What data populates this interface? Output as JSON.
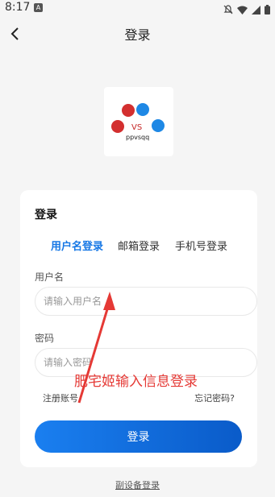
{
  "status_bar": {
    "time": "8:17",
    "notice_glyph": "A",
    "icons": [
      "bell-off-icon",
      "wifi-icon",
      "signal-icon",
      "battery-icon"
    ]
  },
  "header": {
    "title": "登录",
    "back_icon": "chevron-left-icon"
  },
  "logo": {
    "text_vs": "VS",
    "text_name": "ppvsqq"
  },
  "card": {
    "title": "登录",
    "tabs": [
      {
        "label": "用户名登录",
        "active": true
      },
      {
        "label": "邮箱登录",
        "active": false
      },
      {
        "label": "手机号登录",
        "active": false
      }
    ],
    "username": {
      "label": "用户名",
      "placeholder": "请输入用户名"
    },
    "password": {
      "label": "密码",
      "placeholder": "请输入密码"
    },
    "register_link": "注册账号",
    "forgot_link": "忘记密码?",
    "submit_label": "登录"
  },
  "footer_link": "副设备登录",
  "annotation": {
    "text": "肥宅姬输入信息登录",
    "color": "#e53935"
  },
  "colors": {
    "accent": "#1677e5",
    "button_start": "#1a7ff0",
    "button_end": "#0a5bc9"
  }
}
